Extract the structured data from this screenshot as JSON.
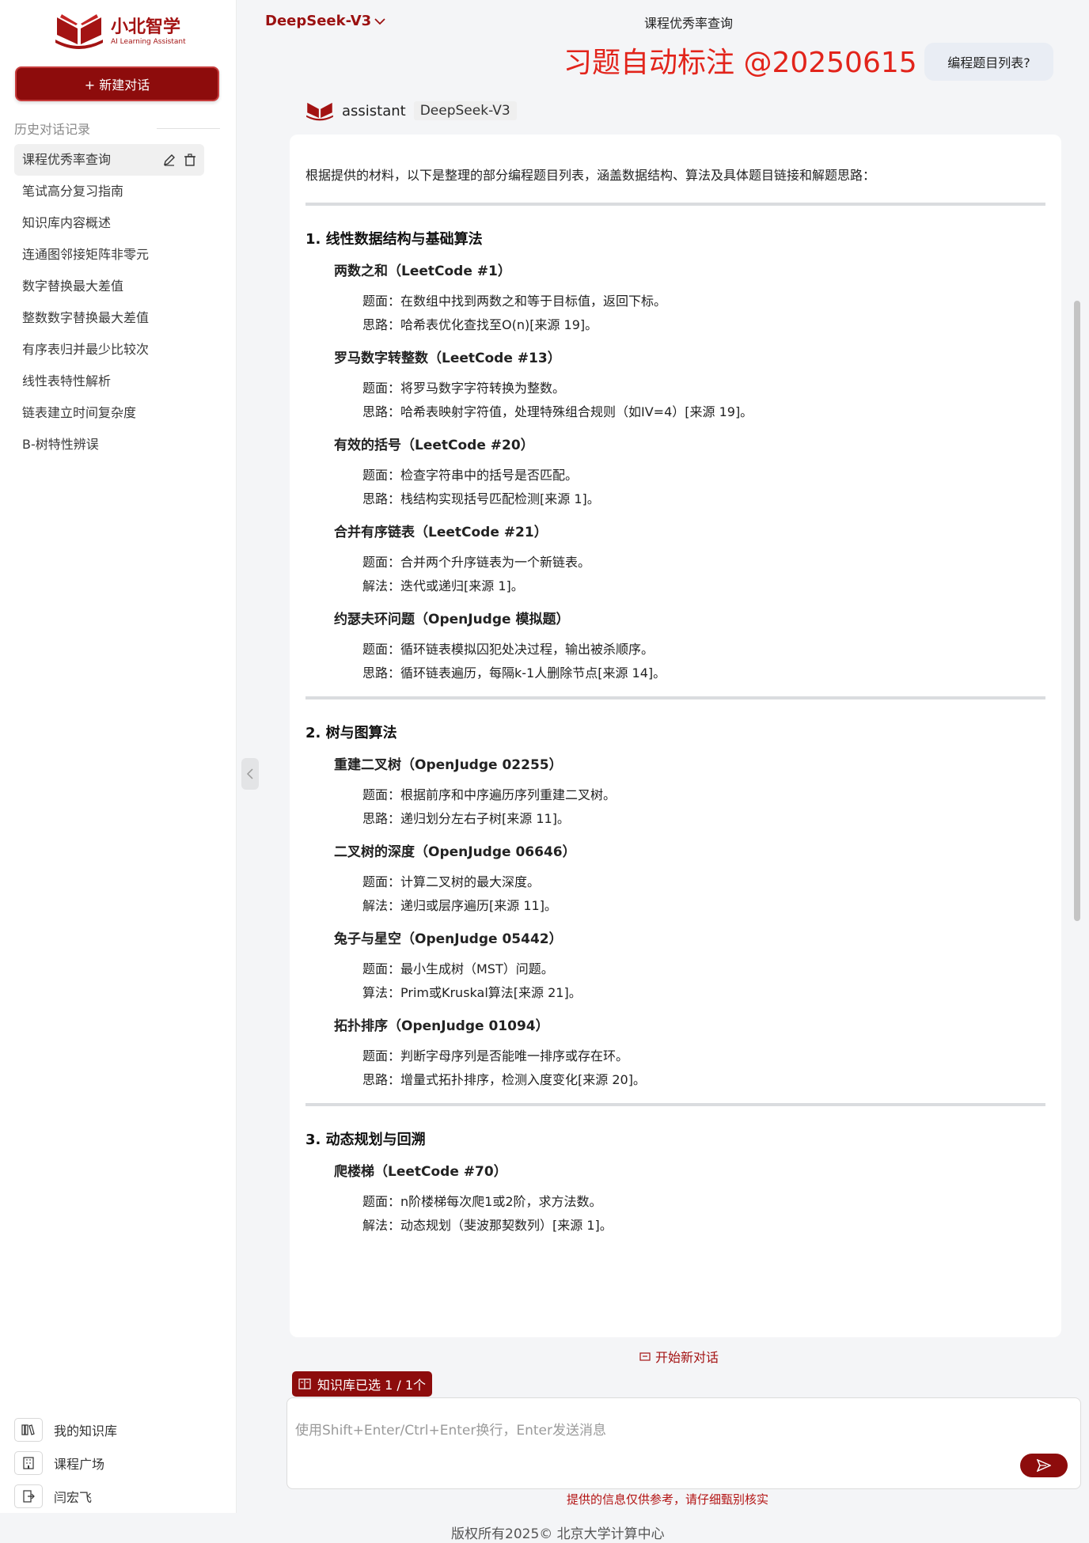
{
  "app": {
    "name": "小北智学",
    "subtitle": "AI Learning Assistant"
  },
  "sidebar": {
    "new_chat": "+ 新建对话",
    "history_title": "历史对话记录",
    "items": [
      {
        "label": "课程优秀率查询"
      },
      {
        "label": "笔试高分复习指南"
      },
      {
        "label": "知识库内容概述"
      },
      {
        "label": "连通图邻接矩阵非零元"
      },
      {
        "label": "数字替换最大差值"
      },
      {
        "label": "整数数字替换最大差值"
      },
      {
        "label": "有序表归并最少比较次"
      },
      {
        "label": "线性表特性解析"
      },
      {
        "label": "链表建立时间复杂度"
      },
      {
        "label": "B-树特性辨误"
      }
    ],
    "bottom": {
      "knowledge": "我的知识库",
      "courses": "课程广场",
      "user": "闫宏飞"
    }
  },
  "header": {
    "model": "DeepSeek-V3",
    "title": "课程优秀率查询"
  },
  "overlay_title": "习题自动标注 @20250615",
  "user_question": "编程题目列表?",
  "assistant": {
    "role": "assistant",
    "model": "DeepSeek-V3",
    "intro": "根据提供的材料，以下是整理的部分编程题目列表，涵盖数据结构、算法及具体题目链接和解题思路：",
    "sections": [
      {
        "title": "1. 线性数据结构与基础算法",
        "problems": [
          {
            "title": "两数之和（LeetCode #1）",
            "lines": [
              "题面：在数组中找到两数之和等于目标值，返回下标。",
              "思路：哈希表优化查找至O(n)[来源 19]。"
            ]
          },
          {
            "title": "罗马数字转整数（LeetCode #13）",
            "lines": [
              "题面：将罗马数字字符转换为整数。",
              "思路：哈希表映射字符值，处理特殊组合规则（如IV=4）[来源 19]。"
            ]
          },
          {
            "title": "有效的括号（LeetCode #20）",
            "lines": [
              "题面：检查字符串中的括号是否匹配。",
              "思路：栈结构实现括号匹配检测[来源 1]。"
            ]
          },
          {
            "title": "合并有序链表（LeetCode #21）",
            "lines": [
              "题面：合并两个升序链表为一个新链表。",
              "解法：迭代或递归[来源 1]。"
            ]
          },
          {
            "title": "约瑟夫环问题（OpenJudge 模拟题）",
            "lines": [
              "题面：循环链表模拟囚犯处决过程，输出被杀顺序。",
              "思路：循环链表遍历，每隔k-1人删除节点[来源 14]。"
            ]
          }
        ]
      },
      {
        "title": "2. 树与图算法",
        "problems": [
          {
            "title": "重建二叉树（OpenJudge 02255）",
            "lines": [
              "题面：根据前序和中序遍历序列重建二叉树。",
              "思路：递归划分左右子树[来源 11]。"
            ]
          },
          {
            "title": "二叉树的深度（OpenJudge 06646）",
            "lines": [
              "题面：计算二叉树的最大深度。",
              "解法：递归或层序遍历[来源 11]。"
            ]
          },
          {
            "title": "兔子与星空（OpenJudge 05442）",
            "lines": [
              "题面：最小生成树（MST）问题。",
              "算法：Prim或Kruskal算法[来源 21]。"
            ]
          },
          {
            "title": "拓扑排序（OpenJudge 01094）",
            "lines": [
              "题面：判断字母序列是否能唯一排序或存在环。",
              "思路：增量式拓扑排序，检测入度变化[来源 20]。"
            ]
          }
        ]
      },
      {
        "title": "3. 动态规划与回溯",
        "problems": [
          {
            "title": "爬楼梯（LeetCode #70）",
            "lines": [
              "题面：n阶楼梯每次爬1或2阶，求方法数。",
              "解法：动态规划（斐波那契数列）[来源 1]。"
            ]
          }
        ]
      }
    ]
  },
  "footer": {
    "new_conversation": "开始新对话",
    "kb_selected": "知识库已选 1 / 1个",
    "input_placeholder": "使用Shift+Enter/Ctrl+Enter换行，Enter发送消息",
    "disclaimer": "提供的信息仅供参考，请仔细甄别核实",
    "copyright": "版权所有2025© 北京大学计算中心"
  },
  "colors": {
    "brand": "#8d0c0c",
    "accent_red": "#e2241b",
    "background": "#f4f5f7"
  },
  "icons": [
    "logo-book-icon",
    "edit-icon",
    "trash-icon",
    "bookshelf-icon",
    "building-icon",
    "logout-icon",
    "chevron-down-icon",
    "chevron-left-icon",
    "new-chat-icon",
    "book-icon",
    "send-icon"
  ]
}
